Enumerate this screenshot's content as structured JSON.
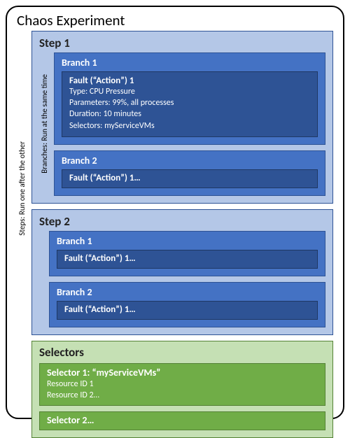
{
  "title": "Chaos Experiment",
  "stepsSideLabel": "Steps: Run one after the other",
  "branchesSideLabel": "Branches: Run at the same time",
  "steps": [
    {
      "title": "Step 1",
      "branches": [
        {
          "title": "Branch 1",
          "fault": {
            "title": "Fault (“Action”) 1",
            "lines": [
              "Type: CPU Pressure",
              "Parameters: 99%, all processes",
              "Duration: 10 minutes",
              "Selectors: myServiceVMs"
            ]
          }
        },
        {
          "title": "Branch 2",
          "fault": {
            "title": "Fault (“Action”) 1…"
          }
        }
      ]
    },
    {
      "title": "Step 2",
      "branches": [
        {
          "title": "Branch 1",
          "fault": {
            "title": "Fault (“Action”) 1…"
          }
        },
        {
          "title": "Branch 2",
          "fault": {
            "title": "Fault (“Action”) 1…"
          }
        }
      ]
    }
  ],
  "selectors": {
    "title": "Selectors",
    "items": [
      {
        "name": "Selector 1: “myServiceVMs”",
        "lines": [
          "Resource ID 1",
          "Resource ID 2…"
        ]
      },
      {
        "name": "Selector 2…"
      }
    ]
  }
}
